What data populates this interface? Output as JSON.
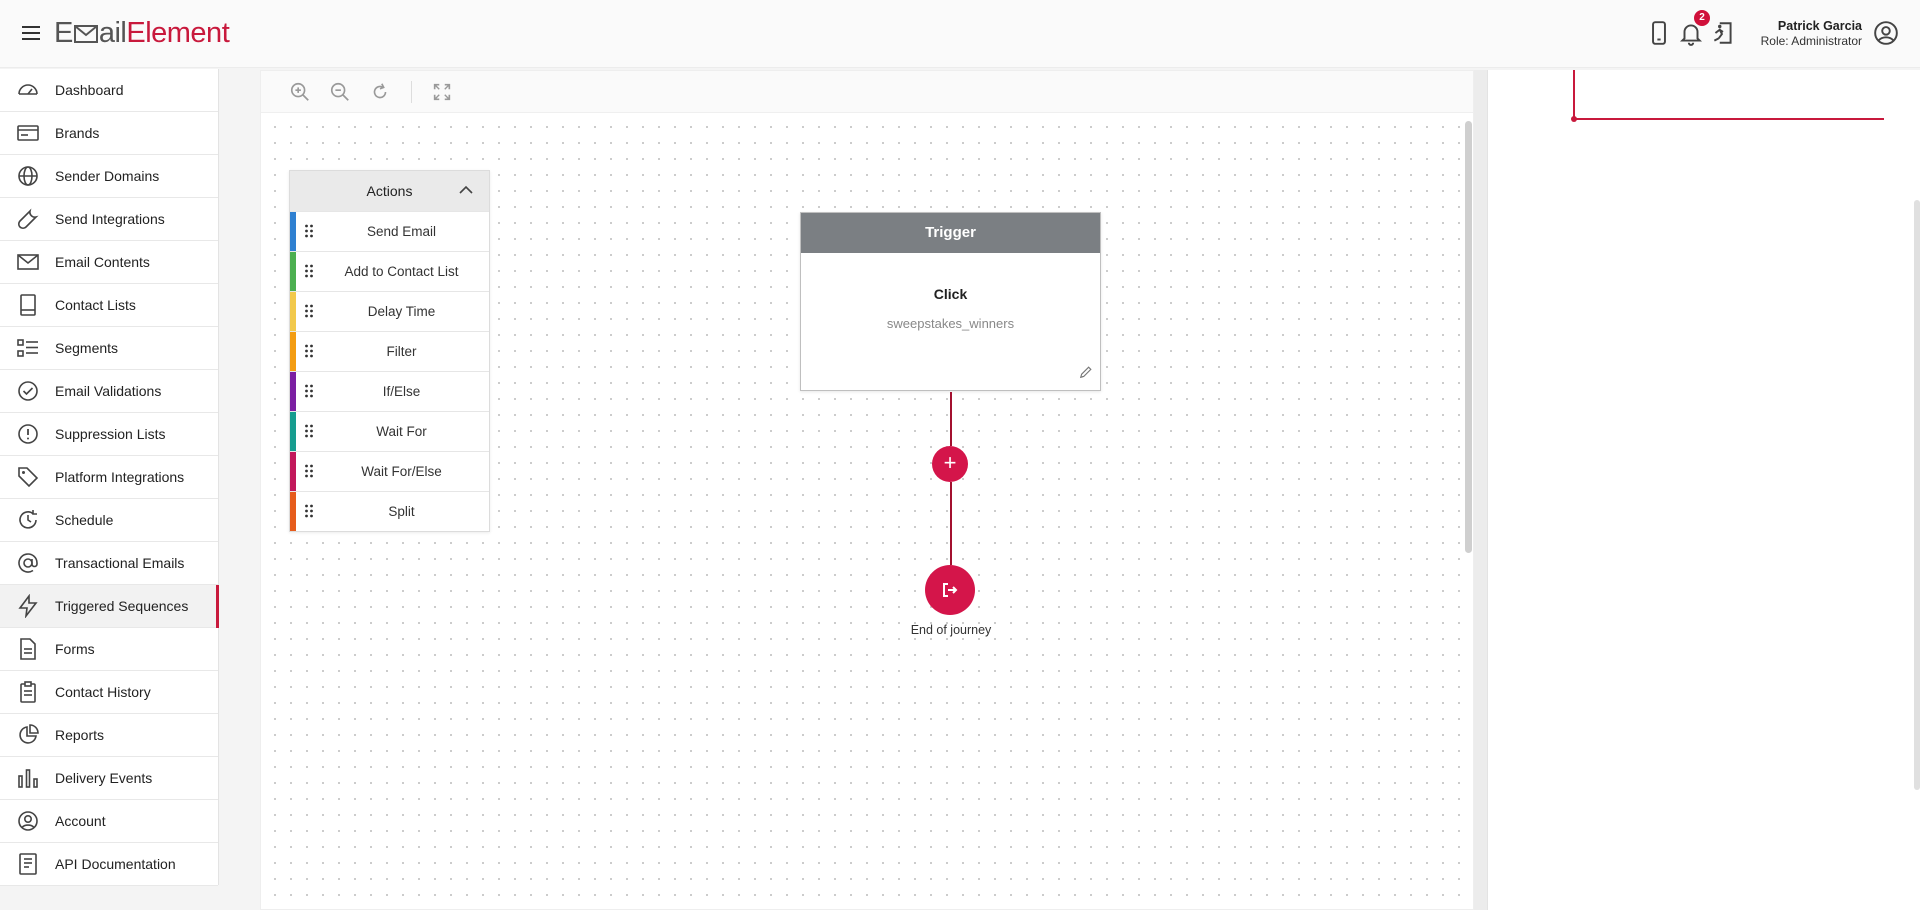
{
  "app": {
    "logo_part1": "E",
    "logo_part2": "ail",
    "logo_part3": "Element",
    "notification_count": "2",
    "user_name": "Patrick Garcia",
    "user_role": "Role: Administrator"
  },
  "sidebar": {
    "items": [
      {
        "label": "Dashboard",
        "icon": "gauge-icon"
      },
      {
        "label": "Brands",
        "icon": "card-icon"
      },
      {
        "label": "Sender Domains",
        "icon": "globe-icon"
      },
      {
        "label": "Send Integrations",
        "icon": "wrench-icon"
      },
      {
        "label": "Email Contents",
        "icon": "envelope-icon"
      },
      {
        "label": "Contact Lists",
        "icon": "book-icon"
      },
      {
        "label": "Segments",
        "icon": "list-icon"
      },
      {
        "label": "Email Validations",
        "icon": "check-circle-icon"
      },
      {
        "label": "Suppression Lists",
        "icon": "alert-circle-icon"
      },
      {
        "label": "Platform Integrations",
        "icon": "tag-icon"
      },
      {
        "label": "Schedule",
        "icon": "clock-refresh-icon"
      },
      {
        "label": "Transactional Emails",
        "icon": "at-icon"
      },
      {
        "label": "Triggered Sequences",
        "icon": "lightning-icon"
      },
      {
        "label": "Forms",
        "icon": "document-icon"
      },
      {
        "label": "Contact History",
        "icon": "clipboard-icon"
      },
      {
        "label": "Reports",
        "icon": "pie-icon"
      },
      {
        "label": "Delivery Events",
        "icon": "bar-chart-icon"
      },
      {
        "label": "Account",
        "icon": "user-circle-icon"
      },
      {
        "label": "API Documentation",
        "icon": "api-doc-icon"
      }
    ],
    "active_index": 12
  },
  "actions_panel": {
    "title": "Actions",
    "items": [
      {
        "label": "Send Email",
        "color": "#2f80d1"
      },
      {
        "label": "Add to Contact List",
        "color": "#4caf50"
      },
      {
        "label": "Delay Time",
        "color": "#f2c94c"
      },
      {
        "label": "Filter",
        "color": "#f39c12"
      },
      {
        "label": "If/Else",
        "color": "#7b1fa2"
      },
      {
        "label": "Wait For",
        "color": "#169c8f"
      },
      {
        "label": "Wait For/Else",
        "color": "#c2185b"
      },
      {
        "label": "Split",
        "color": "#e65c1c"
      }
    ]
  },
  "trigger": {
    "title": "Trigger",
    "event": "Click",
    "detail": "sweepstakes_winners"
  },
  "journey": {
    "add_symbol": "+",
    "end_label": "End of journey"
  },
  "colors": {
    "brand": "#c8193c",
    "accent": "#d4154a"
  }
}
